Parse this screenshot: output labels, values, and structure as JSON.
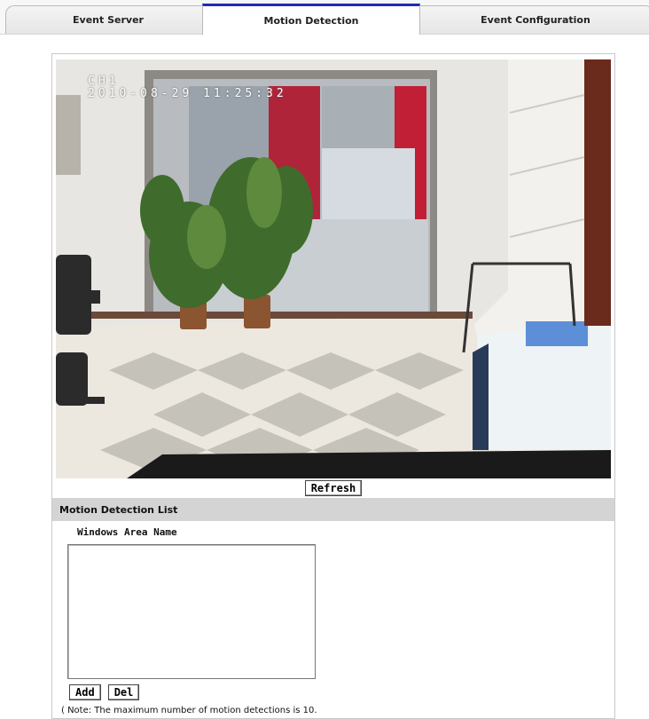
{
  "tabs": [
    {
      "label": "Event Server",
      "active": false
    },
    {
      "label": "Motion Detection",
      "active": true
    },
    {
      "label": "Event Configuration",
      "active": false
    }
  ],
  "video": {
    "channel": "CH1",
    "timestamp": "2010-08-29 11:25:32"
  },
  "refresh_label": "Refresh",
  "motion_list": {
    "heading": "Motion Detection List",
    "column_label": "Windows Area Name",
    "items": [],
    "add_label": "Add",
    "del_label": "Del",
    "note": "( Note: The maximum number of motion detections is 10."
  },
  "colors": {
    "active_tab_accent": "#1e2bb8",
    "section_header_bg": "#d4d4d4"
  }
}
